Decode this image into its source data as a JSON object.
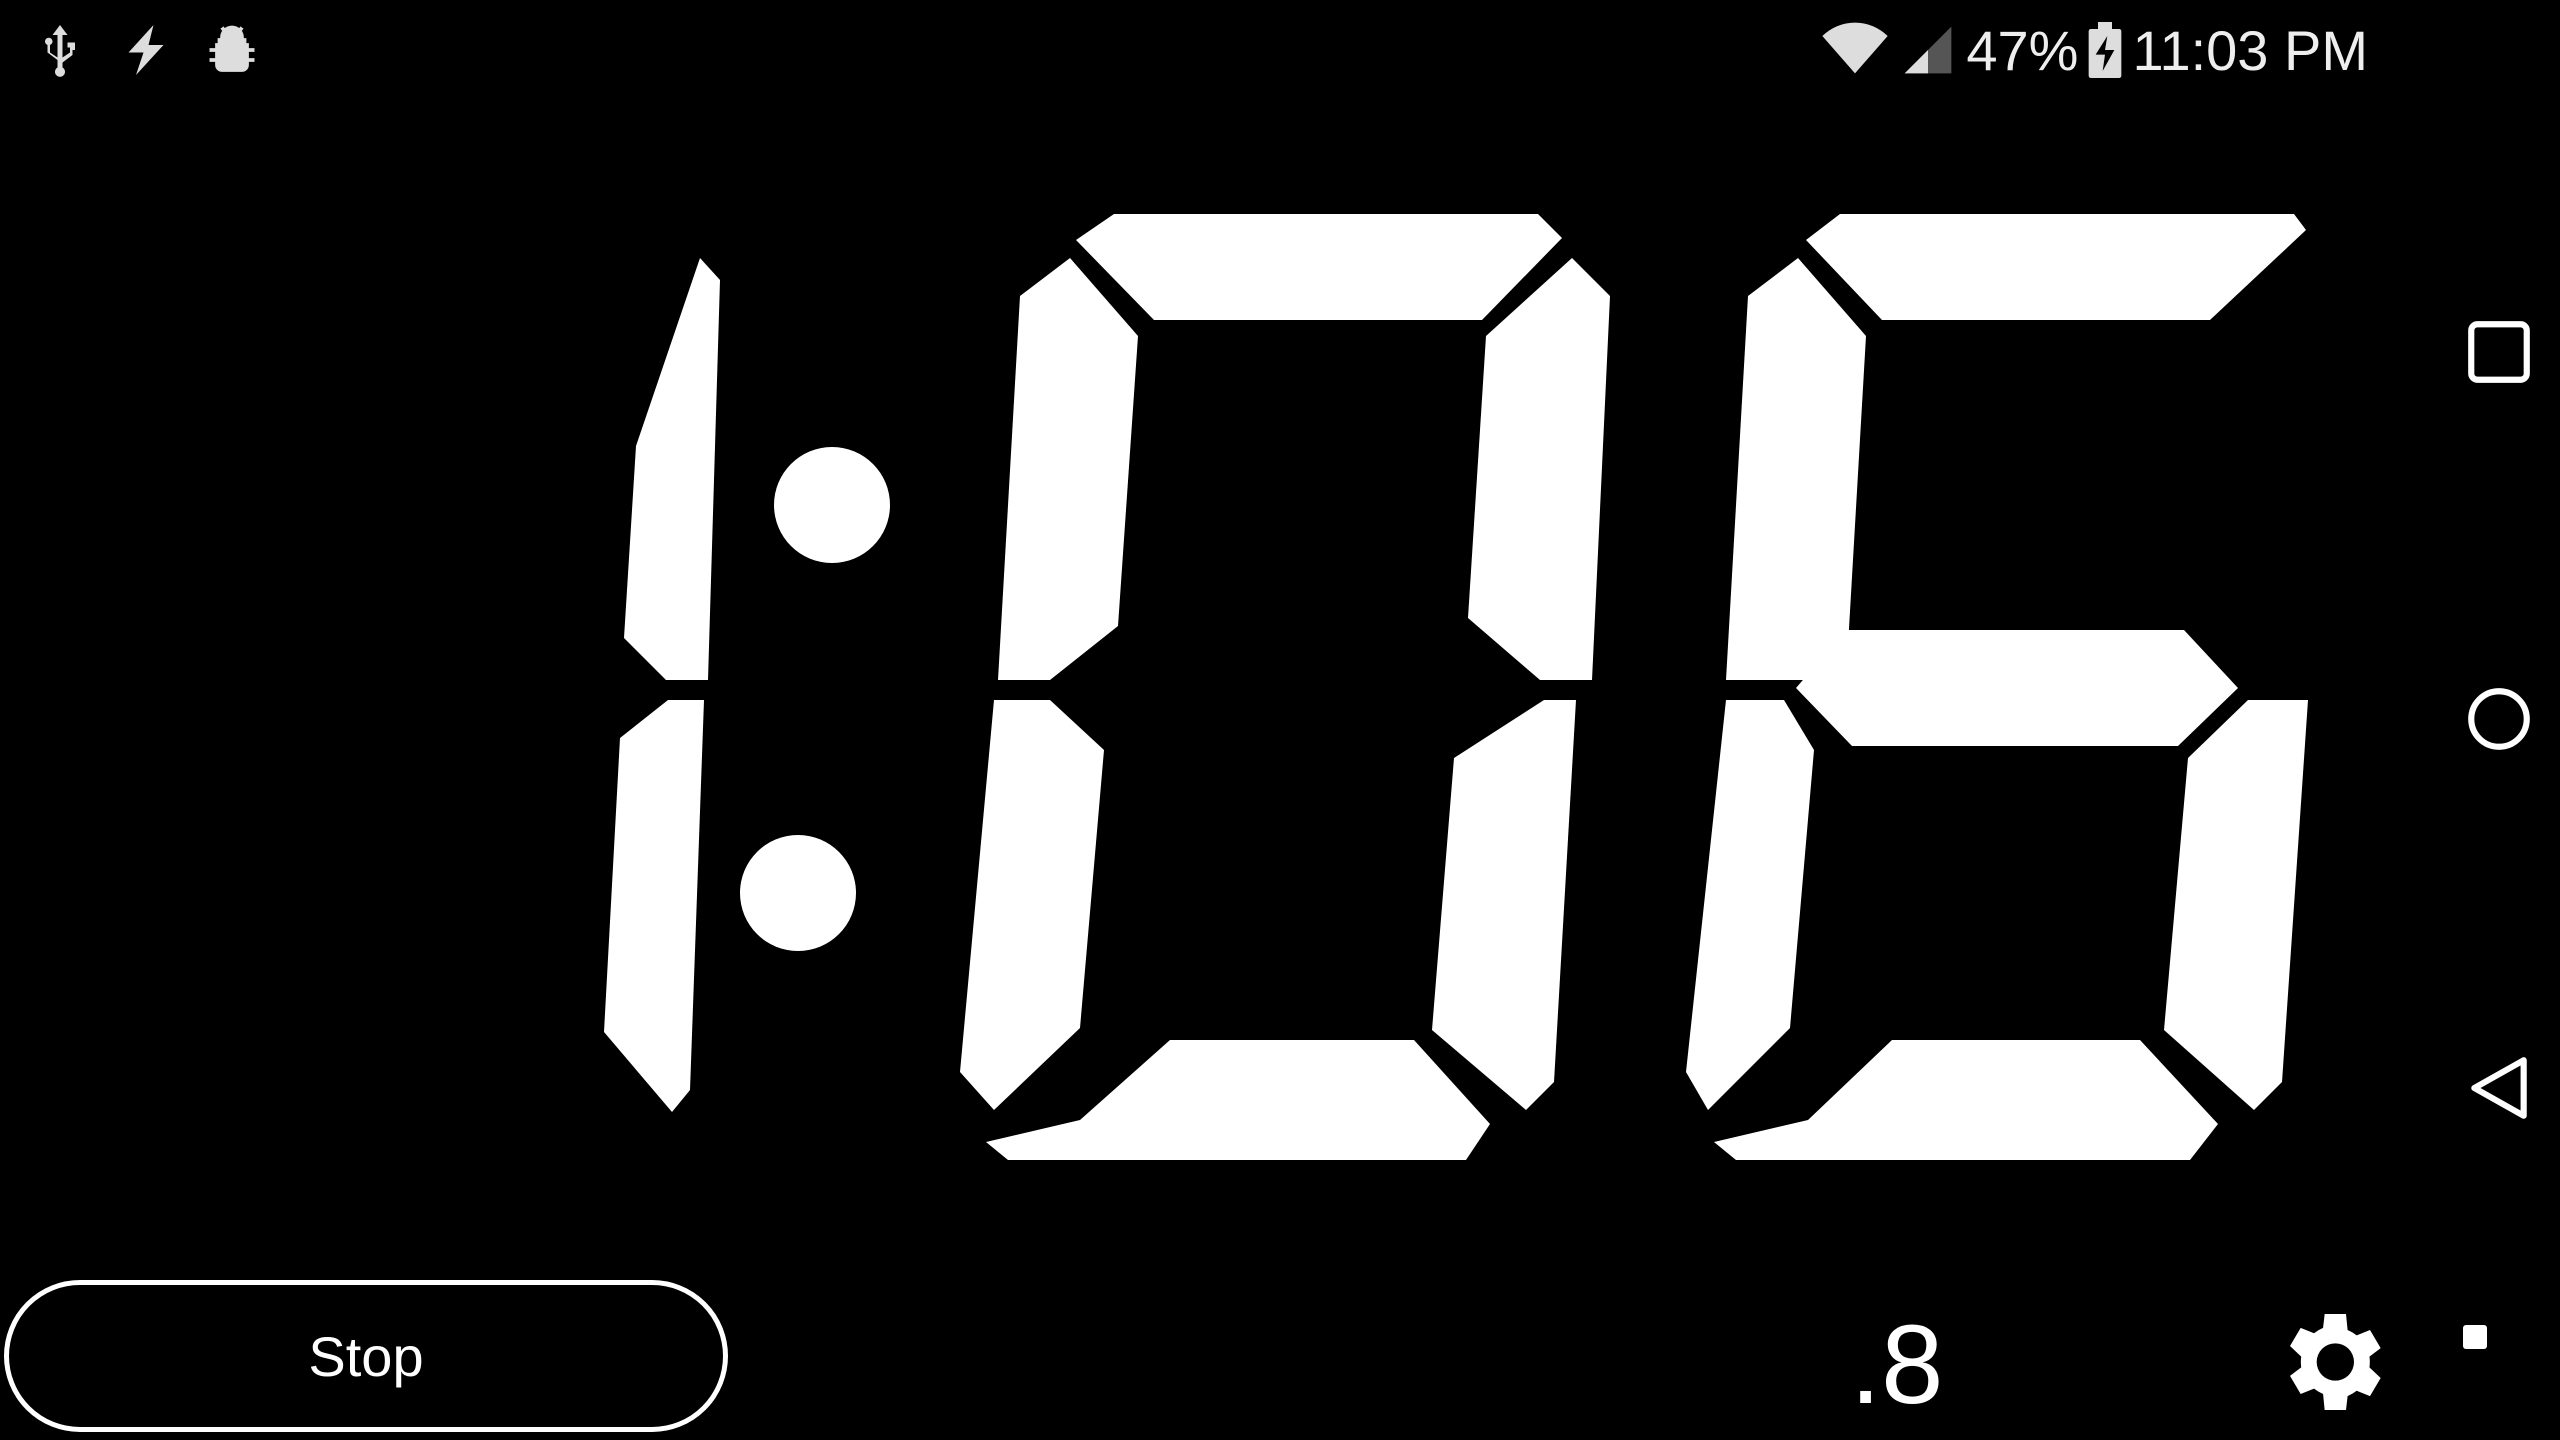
{
  "status_bar": {
    "left_icons": [
      "usb-icon",
      "flash-icon",
      "android-debug-icon"
    ],
    "battery_percent": "47%",
    "time": "11:03 PM",
    "right_icons": [
      "wifi-icon",
      "signal-icon",
      "battery-charging-icon"
    ]
  },
  "clock": {
    "minutes": "1",
    "separator": ":",
    "seconds": "06",
    "tenths": ".8",
    "digits_lit": {
      "digit1": [
        1,
        2
      ],
      "digit2": [
        0,
        1,
        2,
        3,
        4,
        5
      ],
      "digit3": [
        0,
        2,
        3,
        4,
        5,
        6
      ]
    }
  },
  "controls": {
    "stop_label": "Stop",
    "settings_icon": "gear-icon"
  },
  "nav_bar": {
    "icons": [
      "recents-icon",
      "home-icon",
      "back-icon"
    ]
  }
}
